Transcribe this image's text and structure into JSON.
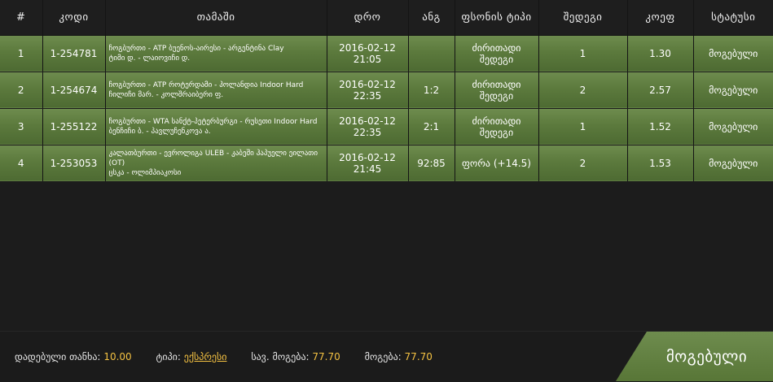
{
  "table": {
    "headers": [
      "#",
      "კოდი",
      "თამაში",
      "დრო",
      "ანგ",
      "ფსონის ტიპი",
      "შედეგი",
      "კოეფ",
      "სტატუსი"
    ],
    "rows": [
      {
        "num": "1",
        "code": "1-254781",
        "event_line1": "ჩოგბურთი - ATP ბუენოს-აირესი - არგენტინა Clay",
        "event_line2": "ტიმი დ. - ლაიოვიჩი დ.",
        "time": "2016-02-12 21:05",
        "score": "",
        "bet_type": "ძირითადი შედეგი",
        "result": "1",
        "odds": "1.30",
        "status": "მოგებული"
      },
      {
        "num": "2",
        "code": "1-254674",
        "event_line1": "ჩოგბურთი - ATP როტერდამი - ჰოლანდია Indoor Hard",
        "event_line2": "ჩილიჩი მარ. - კოლშრაიბერი ფ.",
        "time": "2016-02-12 22:35",
        "score": "1:2",
        "bet_type": "ძირითადი შედეგი",
        "result": "2",
        "odds": "2.57",
        "status": "მოგებული"
      },
      {
        "num": "3",
        "code": "1-255122",
        "event_line1": "ჩოგბურთი - WTA სანქტ-პეტერბურგი - რუსეთი Indoor Hard",
        "event_line2": "ბენჩიჩი ბ. - პავლუჩენკოვა ა.",
        "time": "2016-02-12 22:35",
        "score": "2:1",
        "bet_type": "ძირითადი შედეგი",
        "result": "1",
        "odds": "1.52",
        "status": "მოგებული"
      },
      {
        "num": "4",
        "code": "1-253053",
        "event_line1": "კალათბურთი - ევროლიგა ULEB - კაბეში ჰაპუელი ეილათი (OT)",
        "event_line2": "ცსკა - ოლიმპიაკოსი",
        "time": "2016-02-12 21:45",
        "score": "92:85",
        "bet_type": "ფორა (+14.5)",
        "result": "2",
        "odds": "1.53",
        "status": "მოგებული"
      }
    ]
  },
  "footer": {
    "stake_label": "დადებული თანხა:",
    "stake_value": "10.00",
    "type_label": "ტიპი:",
    "type_value": "ექსპრესი",
    "possible_win_label": "სავ. მოგება:",
    "possible_win_value": "77.70",
    "win_label": "მოგება:",
    "win_value": "77.70",
    "status_button": "მოგებული"
  },
  "colors": {
    "row_green": "#5c7a3d",
    "accent_yellow": "#f5c242",
    "background": "#1c1c1c"
  }
}
